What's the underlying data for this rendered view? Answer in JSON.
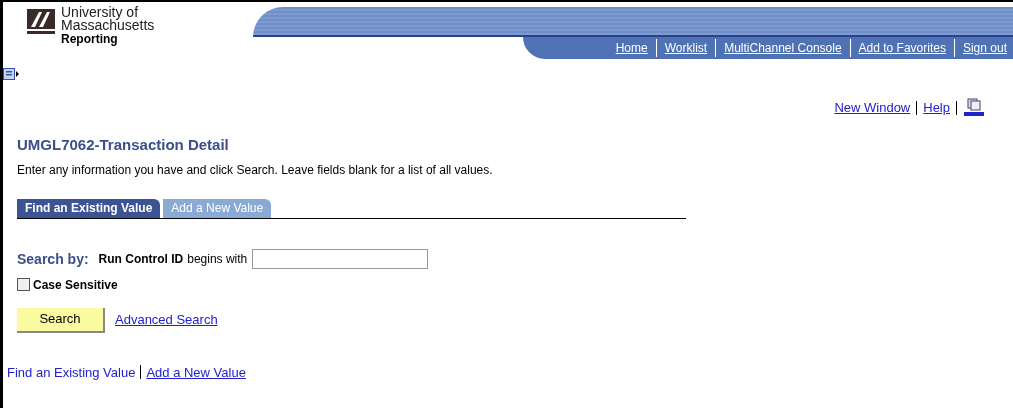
{
  "header": {
    "org_line_1": "University of",
    "org_line_2": "Massachusetts",
    "app": "Reporting"
  },
  "nav": [
    "Home",
    "Worklist",
    "MultiChannel Console",
    "Add to Favorites",
    "Sign out"
  ],
  "toolbar": {
    "links": [
      "New Window",
      "Help"
    ]
  },
  "page": {
    "title": "UMGL7062-Transaction Detail",
    "instructions": "Enter any information you have and click Search. Leave fields blank for a list of all values."
  },
  "tabs": [
    {
      "label": "Find an Existing Value",
      "selected": true
    },
    {
      "label": "Add a New Value",
      "selected": false
    }
  ],
  "search": {
    "heading": "Search by:",
    "field_label": "Run Control ID",
    "operator": "begins with",
    "case_sensitive": {
      "label": "Case Sensitive",
      "checked": false
    },
    "button": "Search",
    "advanced_link": "Advanced Search"
  },
  "footer_links": [
    "Find an Existing Value",
    "Add a New Value"
  ]
}
